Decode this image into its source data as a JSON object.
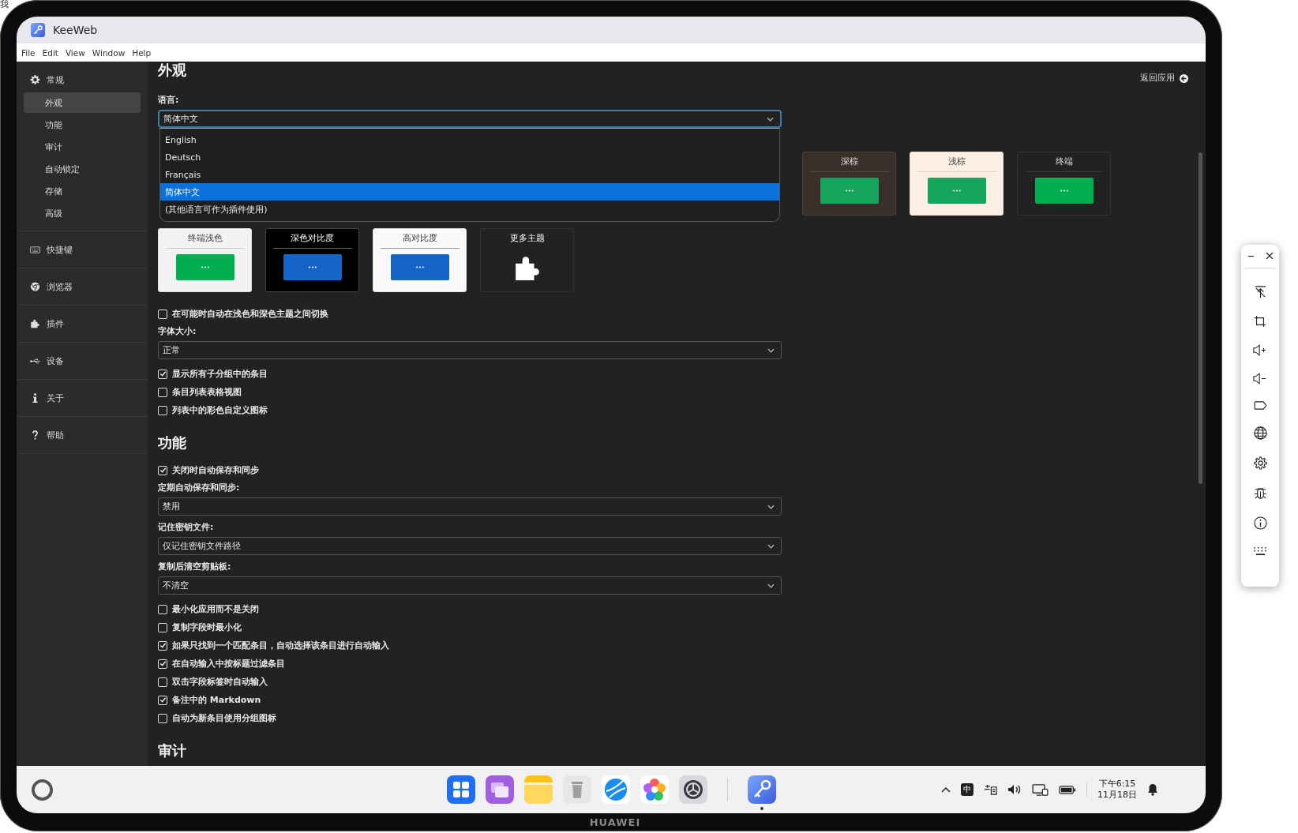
{
  "background_text": "我",
  "window": {
    "title": "KeeWeb"
  },
  "menu": [
    "File",
    "Edit",
    "View",
    "Window",
    "Help"
  ],
  "sidebar": {
    "items": [
      {
        "label": "常规",
        "selected": false,
        "children": [
          {
            "label": "外观",
            "selected": true
          },
          {
            "label": "功能",
            "selected": false
          },
          {
            "label": "审计",
            "selected": false
          },
          {
            "label": "自动锁定",
            "selected": false
          },
          {
            "label": "存储",
            "selected": false
          },
          {
            "label": "高级",
            "selected": false
          }
        ]
      },
      {
        "label": "快捷键",
        "selected": false
      },
      {
        "label": "浏览器",
        "selected": false
      },
      {
        "label": "插件",
        "selected": false
      },
      {
        "label": "设备",
        "selected": false
      },
      {
        "label": "关于",
        "selected": false
      },
      {
        "label": "帮助",
        "selected": false
      }
    ]
  },
  "main": {
    "back_link": "返回应用",
    "sections": [
      {
        "title": "外观",
        "items": [
          {
            "kind": "select",
            "label": "语言:",
            "value": "简体中文",
            "focused": true,
            "expanded": true,
            "options": [
              {
                "label": "English",
                "selected": false
              },
              {
                "label": "Deutsch",
                "selected": false
              },
              {
                "label": "Français",
                "selected": false
              },
              {
                "label": "简体中文",
                "selected": true
              },
              {
                "label": "(其他语言可作为插件使用)",
                "selected": false
              }
            ]
          },
          {
            "kind": "themes",
            "rows": [
              {
                "themes": [
                  {
                    "label": "深棕",
                    "kind": "brown"
                  },
                  {
                    "label": "浅棕",
                    "kind": "beige"
                  },
                  {
                    "label": "终端",
                    "kind": "terminal"
                  }
                ]
              },
              {
                "themes": [
                  {
                    "label": "终端浅色",
                    "kind": "termlight"
                  },
                  {
                    "label": "深色对比度",
                    "kind": "contrast"
                  },
                  {
                    "label": "高对比度",
                    "kind": "highcontrast"
                  },
                  {
                    "label": "更多主题",
                    "kind": "plugin"
                  }
                ]
              }
            ]
          },
          {
            "kind": "checkbox",
            "label": "在可能时自动在浅色和深色主题之间切换",
            "checked": false
          },
          {
            "kind": "select",
            "label": "字体大小:",
            "value": "正常",
            "focused": false
          },
          {
            "kind": "checkbox",
            "label": "显示所有子分组中的条目",
            "checked": true
          },
          {
            "kind": "checkbox",
            "label": "条目列表表格视图",
            "checked": false
          },
          {
            "kind": "checkbox",
            "label": "列表中的彩色自定义图标",
            "checked": false
          }
        ]
      },
      {
        "title": "功能",
        "items": [
          {
            "kind": "checkbox",
            "label": "关闭时自动保存和同步",
            "checked": true
          },
          {
            "kind": "select",
            "label": "定期自动保存和同步:",
            "value": "禁用",
            "focused": false
          },
          {
            "kind": "select",
            "label": "记住密钥文件:",
            "value": "仅记住密钥文件路径",
            "focused": false
          },
          {
            "kind": "select",
            "label": "复制后清空剪贴板:",
            "value": "不清空",
            "focused": false
          },
          {
            "kind": "checkbox",
            "label": "最小化应用而不是关闭",
            "checked": false
          },
          {
            "kind": "checkbox",
            "label": "复制字段时最小化",
            "checked": false
          },
          {
            "kind": "checkbox",
            "label": "如果只找到一个匹配条目，自动选择该条目进行自动输入",
            "checked": true
          },
          {
            "kind": "checkbox",
            "label": "在自动输入中按标题过滤条目",
            "checked": true
          },
          {
            "kind": "checkbox",
            "label": "双击字段标签时自动输入",
            "checked": false
          },
          {
            "kind": "checkbox",
            "label": "备注中的 Markdown",
            "checked": true
          },
          {
            "kind": "checkbox",
            "label": "自动为新条目使用分组图标",
            "checked": false
          }
        ]
      },
      {
        "title": "审计"
      }
    ]
  },
  "taskbar": {
    "open_apps": [
      {
        "running": true
      }
    ],
    "input_method": "中",
    "clock": {
      "time": "下午6:15",
      "date": "11月18日"
    }
  },
  "brand": "HUAWEI"
}
